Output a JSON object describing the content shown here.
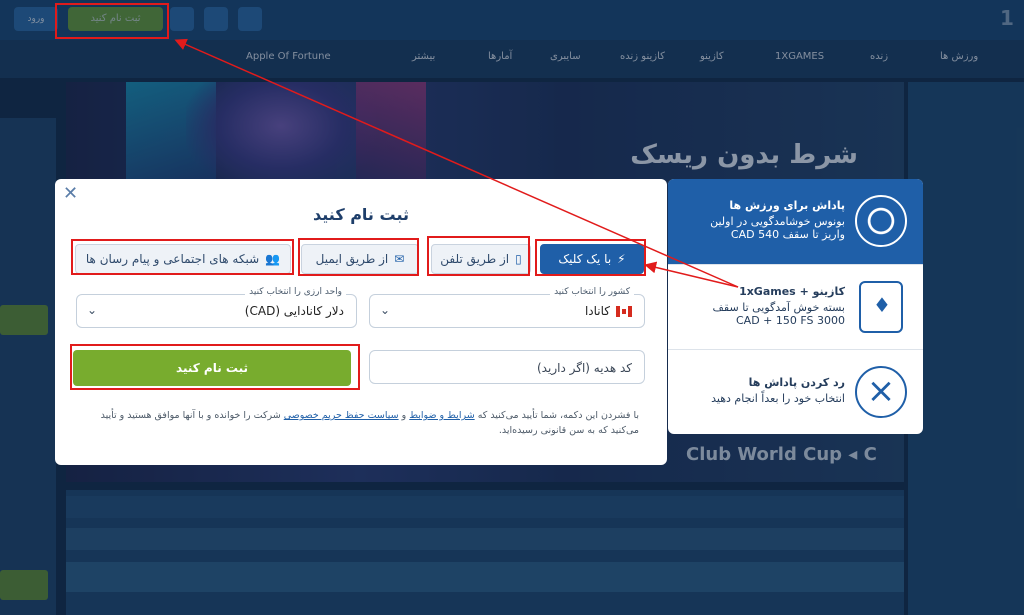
{
  "header": {
    "register_label": "ثبت نام کنید",
    "login_label": "ورود",
    "logo_text": "1"
  },
  "nav": {
    "items": [
      "ورزش ها",
      "زنده",
      "1XGAMES",
      "کازینو",
      "کازینو زنده",
      "سایبری",
      "آمارها",
      "بیشتر",
      "Apple Of Fortune"
    ]
  },
  "banner": {
    "title": "شرط بدون ریسک",
    "strip": "Club World Cup  ◂  C"
  },
  "modal": {
    "close_label": "✕",
    "title": "ثبت نام کنید",
    "tabs": [
      {
        "label": "با یک کلیک",
        "icon": "lightning-icon",
        "glyph": "⚡"
      },
      {
        "label": "از طریق تلفن",
        "icon": "phone-icon",
        "glyph": "▯"
      },
      {
        "label": "از طریق ایمیل",
        "icon": "envelope-icon",
        "glyph": "✉"
      },
      {
        "label": "شبکه های اجتماعی و پیام رسان ها",
        "icon": "users-icon",
        "glyph": "👥"
      }
    ],
    "country": {
      "label": "کشور را انتخاب کنید",
      "value": "کانادا"
    },
    "currency": {
      "label": "واحد ارزی را انتخاب کنید",
      "value": "دلار کانادایی (CAD)"
    },
    "promo": {
      "placeholder": "کد هدیه (اگر دارید)"
    },
    "submit_label": "ثبت نام کنید",
    "terms": {
      "part1": "با فشردن این دکمه، شما تأیید می‌کنید که",
      "link1": "شرایط و ضوابط",
      "part2": "و",
      "link2": "سیاست حفظ حریم خصوصی",
      "part3": "شرکت را خوانده و با آنها موافق هستید و تأیید می‌کنید که به سن قانونی رسیده‌اید."
    }
  },
  "bonus": {
    "sport": {
      "title": "پاداش برای ورزش ها",
      "desc1": "بونوس خوشامدگویی در اولین",
      "desc2": "واریز تا سقف 540 CAD",
      "icon": "soccer-ball-icon"
    },
    "casino": {
      "title": "کازینو + 1xGames",
      "desc1": "بسته خوش آمدگویی تا سقف",
      "desc2": "CAD + 150 FS 3000",
      "icon": "cards-dice-icon"
    },
    "cancel": {
      "title": "رد کردن پاداش ها",
      "desc": "انتخاب خود را بعداً انجام دهید",
      "icon": "x-circle-icon"
    }
  },
  "colors": {
    "accent_blue": "#1f5fa8",
    "green": "#78ac2e",
    "highlight_red": "#e11b1b"
  }
}
